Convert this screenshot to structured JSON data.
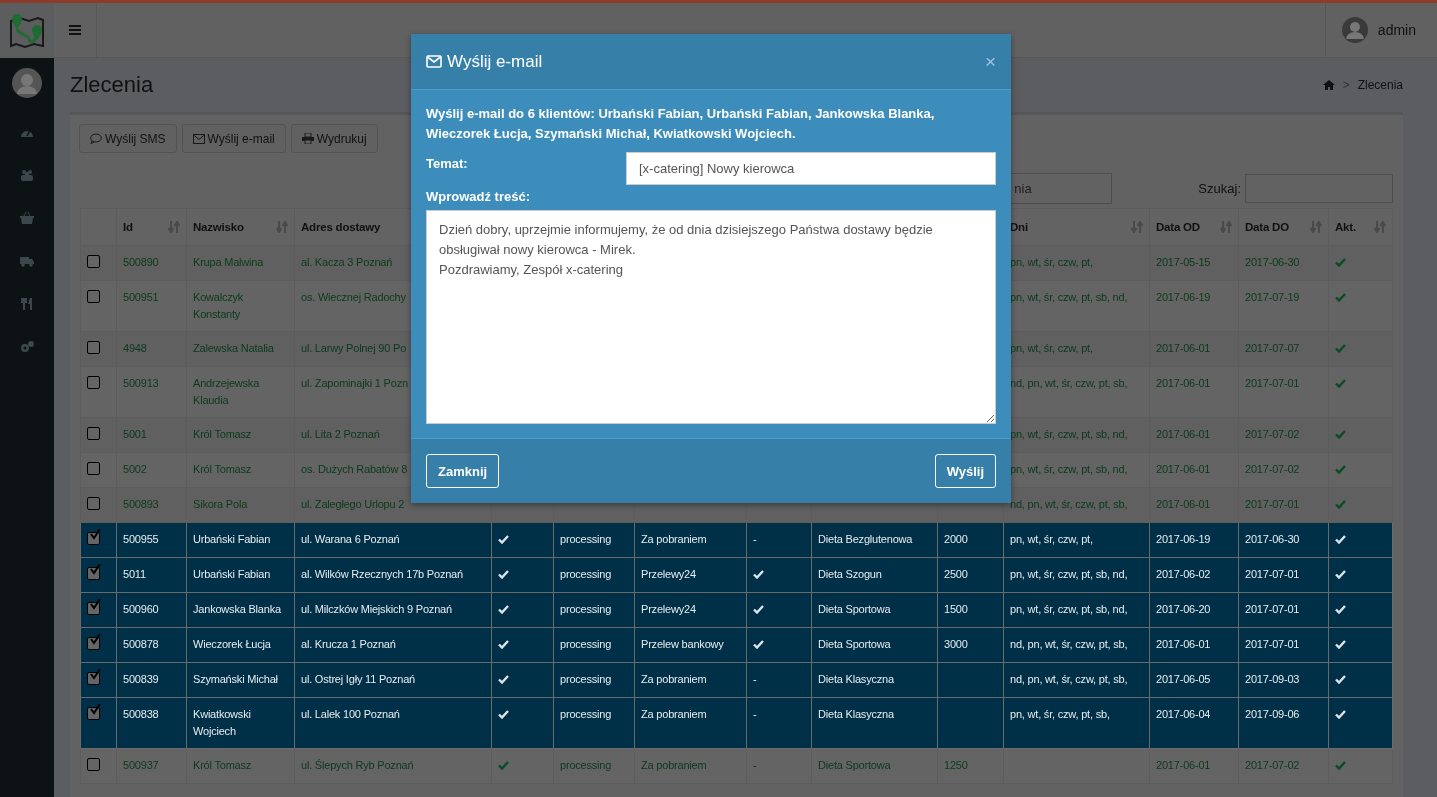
{
  "topbar": {
    "user": "admin"
  },
  "page": {
    "title": "Zlecenia",
    "breadcrumb_separator": ">",
    "breadcrumb": "Zlecenia"
  },
  "toolbar": [
    "Wyślij SMS",
    "Wyślij e-mail",
    "Wydrukuj"
  ],
  "filter": {
    "placeholder": "nia"
  },
  "search": {
    "label": "Szukaj:"
  },
  "table": {
    "columns": [
      {
        "label": "Id",
        "sortable": true
      },
      {
        "label": "Nazwisko",
        "sortable": true
      },
      {
        "label": "Adres dostawy",
        "sortable": false
      },
      {
        "label": "Dni",
        "sortable": true
      },
      {
        "label": "Data OD",
        "sortable": true
      },
      {
        "label": "Data DO",
        "sortable": true
      },
      {
        "label": "Akt.",
        "sortable": true
      }
    ],
    "rows": [
      {
        "selected": false,
        "id": "500890",
        "name": "Krupa Malwina",
        "address": "al. Kacza 3 Poznań",
        "days": "pn, wt, śr, czw, pt,",
        "from": "2017-05-15",
        "to": "2017-06-30",
        "active": true
      },
      {
        "selected": false,
        "id": "500951",
        "name": "Kowalczyk Konstanty",
        "address": "os. Wiecznej Radochy",
        "days": "pn, wt, śr, czw, pt, sb, nd,",
        "from": "2017-06-19",
        "to": "2017-07-19",
        "active": true
      },
      {
        "selected": false,
        "id": "4948",
        "name": "Zalewska Natalia",
        "address": "ul. Larwy Polnej 90 Po",
        "days": "pn, wt, śr, czw, pt,",
        "from": "2017-06-01",
        "to": "2017-07-07",
        "active": true
      },
      {
        "selected": false,
        "id": "500913",
        "name": "Andrzejewska Klaudia",
        "address": "ul. Zapominajki 1 Pozn",
        "days": "nd, pn, wt, śr, czw, pt, sb,",
        "from": "2017-06-01",
        "to": "2017-07-01",
        "active": true
      },
      {
        "selected": false,
        "id": "5001",
        "name": "Król Tomasz",
        "address": "ul. Lita 2 Poznań",
        "days": "pn, wt, śr, czw, pt, sb, nd,",
        "from": "2017-06-01",
        "to": "2017-07-02",
        "active": true
      },
      {
        "selected": false,
        "id": "5002",
        "name": "Król Tomasz",
        "address": "os. Dużych Rabatów 8",
        "days": "pn, wt, śr, czw, pt, sb, nd,",
        "from": "2017-06-01",
        "to": "2017-07-02",
        "active": true
      },
      {
        "selected": false,
        "id": "500893",
        "name": "Sikora Pola",
        "address": "ul. Zaległego Urlopu 2",
        "days": "nd, pn, wt, śr, czw, pt, sb,",
        "from": "2017-06-01",
        "to": "2017-07-01",
        "active": true
      },
      {
        "selected": true,
        "id": "500955",
        "name": "Urbański Fabian",
        "address": "ul. Warana 6 Poznań",
        "column_4_checked": true,
        "status": "processing",
        "payment": "Za pobraniem",
        "column_7_checked": false,
        "column_7": "-",
        "diet": "Dieta Bezglutenowa",
        "column_9": "2000",
        "days": "pn, wt, śr, czw, pt,",
        "from": "2017-06-19",
        "to": "2017-06-30",
        "active": true
      },
      {
        "selected": true,
        "id": "5011",
        "name": "Urbański Fabian",
        "address": "al. Wilków Rzecznych 17b Poznań",
        "column_4_checked": true,
        "status": "processing",
        "payment": "Przelewy24",
        "column_7_checked": true,
        "diet": "Dieta Szogun",
        "column_9": "2500",
        "days": "pn, wt, śr, czw, pt, sb, nd,",
        "from": "2017-06-02",
        "to": "2017-07-01",
        "active": true
      },
      {
        "selected": true,
        "id": "500960",
        "name": "Jankowska Blanka",
        "address": "ul. Milczków Miejskich 9 Poznań",
        "column_4_checked": true,
        "status": "processing",
        "payment": "Przelewy24",
        "column_7_checked": true,
        "diet": "Dieta Sportowa",
        "column_9": "1500",
        "days": "pn, wt, śr, czw, pt, sb, nd,",
        "from": "2017-06-20",
        "to": "2017-07-01",
        "active": true
      },
      {
        "selected": true,
        "id": "500878",
        "name": "Wieczorek Łucja",
        "address": "al. Krucza 1 Poznań",
        "column_4_checked": true,
        "status": "processing",
        "payment": "Przelew bankowy",
        "column_7_checked": true,
        "diet": "Dieta Sportowa",
        "column_9": "3000",
        "days": "nd, pn, wt, śr, czw, pt, sb,",
        "from": "2017-06-01",
        "to": "2017-07-01",
        "active": true
      },
      {
        "selected": true,
        "id": "500839",
        "name": "Szymański Michał",
        "address": "ul. Ostrej Igły 11 Poznań",
        "column_4_checked": true,
        "status": "processing",
        "payment": "Za pobraniem",
        "column_7_checked": false,
        "column_7": "-",
        "diet": "Dieta Klasyczna",
        "days": "nd, pn, wt, śr, czw, pt, sb,",
        "from": "2017-06-05",
        "to": "2017-09-03",
        "active": true
      },
      {
        "selected": true,
        "id": "500838",
        "name": "Kwiatkowski Wojciech",
        "address": "ul. Lalek 100 Poznań",
        "column_4_checked": true,
        "status": "processing",
        "payment": "Za pobraniem",
        "column_7_checked": false,
        "column_7": "-",
        "diet": "Dieta Klasyczna",
        "days": "pn, wt, śr, czw, pt, sb,",
        "from": "2017-06-04",
        "to": "2017-09-06",
        "active": true
      },
      {
        "selected": false,
        "id": "500937",
        "name": "Król Tomasz",
        "address": "ul. Ślepych Ryb Poznań",
        "column_4_checked": true,
        "status": "processing",
        "payment": "Za pobraniem",
        "column_7_checked": false,
        "column_7": "-",
        "diet": "Dieta Sportowa",
        "column_9": "1250",
        "from": "2017-06-01",
        "to": "2017-07-02",
        "active": true
      }
    ]
  },
  "modal": {
    "title": "Wyślij e-mail",
    "close": "×",
    "intro": "Wyślij e-mail do **6** klientów: Urbański Fabian, Urbański Fabian, Jankowska Blanka, Wieczorek Łucja, Szymański Michał, Kwiatkowski Wojciech.",
    "subject_label": "Temat:",
    "subject": "[x-catering] Nowy kierowca",
    "body_label": "Wprowadź treść:",
    "body": "Dzień dobry, uprzejmie informujemy, że od dnia dzisiejszego Państwa dostawy będzie obsługiwał nowy kierowca - Mirek.\nPozdrawiamy, Zespół x-catering",
    "buttons": [
      "Zamknij",
      "Wyślij"
    ]
  }
}
